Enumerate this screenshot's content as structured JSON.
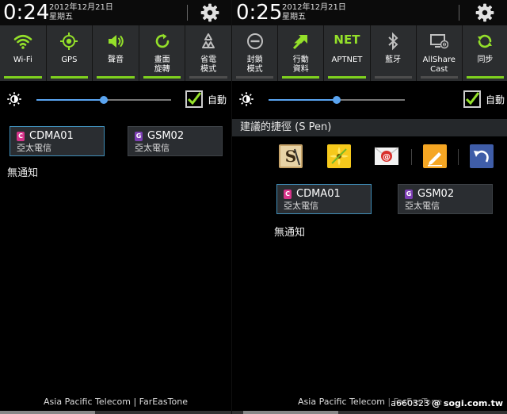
{
  "colors": {
    "accent_green": "#7fd11e",
    "icon_green": "#94e02a",
    "tile_bg": "#2b2d2f",
    "slider_blue": "#5aa4f0",
    "sim_active_border": "#3f8db7",
    "cdma_color": "#d6338a",
    "gsm_color": "#7e3fb5"
  },
  "left": {
    "status": {
      "time": "0:24",
      "date": "2012年12月21日",
      "weekday": "星期五",
      "settings_icon": "gear-icon"
    },
    "tiles": [
      {
        "icon": "wifi-icon",
        "label": "Wi-Fi",
        "on": true
      },
      {
        "icon": "gps-icon",
        "label": "GPS",
        "on": true
      },
      {
        "icon": "volume-icon",
        "label": "聲音",
        "on": true
      },
      {
        "icon": "rotate-icon",
        "label": "畫面\n旋轉",
        "on": true
      },
      {
        "icon": "recycle-icon",
        "label": "省電\n模式",
        "on": false
      }
    ],
    "brightness": {
      "icon": "brightness-icon",
      "level": 0.5,
      "auto_checked": true,
      "auto_label": "自動"
    },
    "sims": [
      {
        "badge": "C",
        "name": "CDMA01",
        "operator": "亞太電信",
        "active": true
      },
      {
        "badge": "G",
        "name": "GSM02",
        "operator": "亞太電信",
        "active": false
      }
    ],
    "no_notifications": "無通知",
    "carrier": "Asia Pacific Telecom | FarEasTone"
  },
  "right": {
    "status": {
      "time": "0:25",
      "date": "2012年12月21日",
      "weekday": "星期五",
      "settings_icon": "gear-icon"
    },
    "tiles": [
      {
        "icon": "block-icon",
        "label": "封鎖\n模式",
        "on": false
      },
      {
        "icon": "data-transfer-icon",
        "label": "行動\n資料",
        "on": true
      },
      {
        "icon": "",
        "text": "NET",
        "label": "APTNET",
        "on": true
      },
      {
        "icon": "bluetooth-icon",
        "label": "藍牙",
        "on": false
      },
      {
        "icon": "allshare-cast-icon",
        "label": "AllShare\nCast",
        "on": false
      },
      {
        "icon": "sync-icon",
        "label": "同步",
        "on": true
      }
    ],
    "brightness": {
      "icon": "brightness-icon",
      "level": 0.5,
      "auto_checked": true,
      "auto_label": "自動"
    },
    "spen_title": "建議的捷徑 (S Pen)",
    "spen_apps": [
      {
        "icon": "s-note-icon"
      },
      {
        "icon": "gallery-icon"
      },
      {
        "icon": "email-icon"
      },
      {
        "icon": "memo-icon"
      },
      {
        "icon": "undo-icon"
      }
    ],
    "sims": [
      {
        "badge": "C",
        "name": "CDMA01",
        "operator": "亞太電信",
        "active": true
      },
      {
        "badge": "G",
        "name": "GSM02",
        "operator": "亞太電信",
        "active": false
      }
    ],
    "no_notifications": "無通知",
    "carrier": "Asia Pacific Telecom | FarEasTone"
  },
  "watermark": {
    "user": "a660323",
    "site": "@ sogi.com.tw"
  }
}
